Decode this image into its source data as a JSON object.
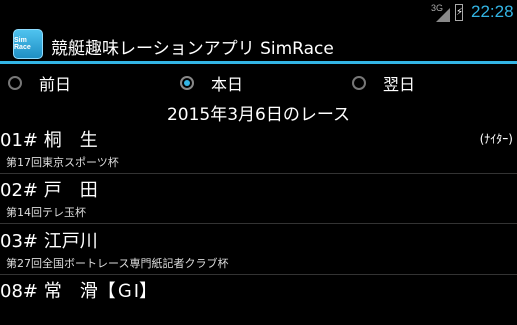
{
  "status_bar": {
    "network": "3G",
    "time": "22:28"
  },
  "app": {
    "icon_text": "Sim Race",
    "title": "競艇趣味レーションアプリ SimRace"
  },
  "day_selector": {
    "options": [
      {
        "label": "前日",
        "checked": false
      },
      {
        "label": "本日",
        "checked": true
      },
      {
        "label": "翌日",
        "checked": false
      }
    ]
  },
  "heading": "2015年3月6日のレース",
  "races": [
    {
      "title": "01# 桐　生",
      "note": "(ﾅｲﾀｰ)",
      "subtitle": "第17回東京スポーツ杯"
    },
    {
      "title": "02# 戸　田",
      "note": "",
      "subtitle": "第14回テレ玉杯"
    },
    {
      "title": "03# 江戸川",
      "note": "",
      "subtitle": "第27回全国ボートレース専門紙記者クラブ杯"
    },
    {
      "title": "08# 常　滑【ＧⅠ】",
      "note": "",
      "subtitle": ""
    }
  ],
  "colors": {
    "accent": "#33b5e5",
    "background": "#000000"
  }
}
